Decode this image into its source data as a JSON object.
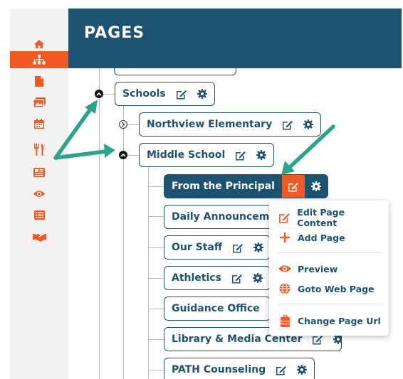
{
  "header": {
    "title": "PAGES"
  },
  "sidebar": {
    "items": [
      {
        "icon": "home-icon",
        "active": false
      },
      {
        "icon": "sitemap-icon",
        "active": true
      },
      {
        "icon": "file-icon",
        "active": false
      },
      {
        "icon": "images-icon",
        "active": false
      },
      {
        "icon": "calendar-icon",
        "active": false
      },
      {
        "icon": "utensils-icon",
        "active": false
      },
      {
        "icon": "newspaper-icon",
        "active": false
      },
      {
        "icon": "eye-icon",
        "active": false
      },
      {
        "icon": "list-icon",
        "active": false
      },
      {
        "icon": "handshake-icon",
        "active": false
      }
    ]
  },
  "tree": {
    "schools": "Schools",
    "northview": "Northview Elementary",
    "middle_school": "Middle School",
    "children": [
      "From the Principal",
      "Daily Announcements",
      "Our Staff",
      "Athletics",
      "Guidance Office",
      "Library & Media Center",
      "PATH Counseling"
    ]
  },
  "context_menu": {
    "items": [
      {
        "label": "Edit Page Content",
        "icon": "edit-icon"
      },
      {
        "label": "Add Page",
        "icon": "plus-icon"
      },
      {
        "label": "Preview",
        "icon": "eye-icon"
      },
      {
        "label": "Goto Web Page",
        "icon": "globe-icon"
      },
      {
        "label": "Change Page Url",
        "icon": "suitcase-icon"
      }
    ]
  },
  "colors": {
    "brand": "#1d5270",
    "accent": "#f15a22",
    "annotation": "#2aa58c"
  }
}
